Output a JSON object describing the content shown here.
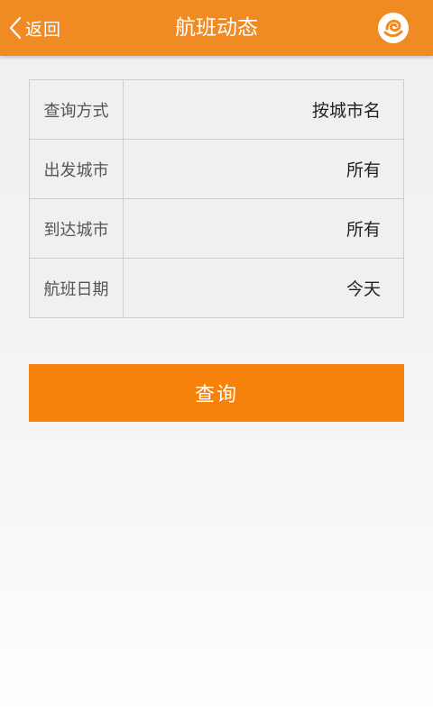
{
  "header": {
    "back_label": "返回",
    "title": "航班动态",
    "logo_icon": "swirl-logo-icon"
  },
  "form": {
    "rows": [
      {
        "label": "查询方式",
        "value": "按城市名"
      },
      {
        "label": "出发城市",
        "value": "所有"
      },
      {
        "label": "到达城市",
        "value": "所有"
      },
      {
        "label": "航班日期",
        "value": "今天"
      }
    ]
  },
  "query_button": {
    "label": "查询"
  },
  "colors": {
    "header": "#f08a22",
    "button": "#f7820b"
  }
}
